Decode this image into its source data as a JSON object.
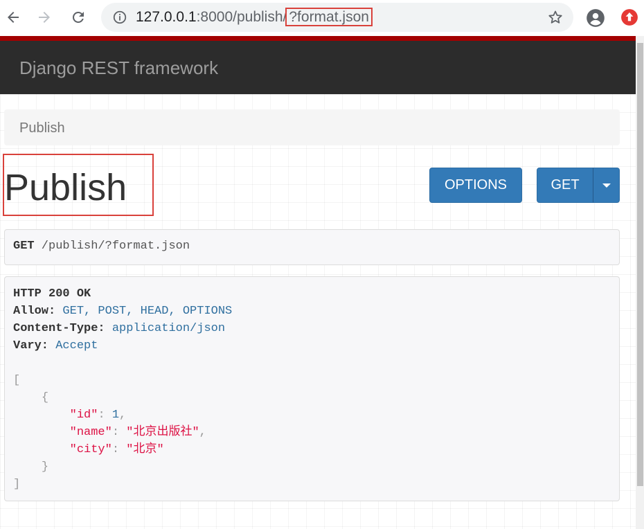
{
  "browser": {
    "url_host": "127.0.0.1",
    "url_port_path": ":8000/publish/",
    "url_query": "?format.json"
  },
  "navbar": {
    "brand": "Django REST framework"
  },
  "breadcrumb": {
    "current": "Publish"
  },
  "page": {
    "title": "Publish"
  },
  "buttons": {
    "options": "OPTIONS",
    "get": "GET"
  },
  "request": {
    "method": "GET",
    "path": " /publish/?format.json"
  },
  "response": {
    "status": "HTTP 200 OK",
    "headers": [
      {
        "name": "Allow:",
        "value": " GET, POST, HEAD, OPTIONS"
      },
      {
        "name": "Content-Type:",
        "value": " application/json"
      },
      {
        "name": "Vary:",
        "value": " Accept"
      }
    ],
    "body": {
      "open_bracket": "[",
      "open_brace": "{",
      "id_key": "\"id\"",
      "id_value": "1",
      "name_key": "\"name\"",
      "name_value": "\"北京出版社\"",
      "city_key": "\"city\"",
      "city_value": "\"北京\"",
      "close_brace": "}",
      "close_bracket": "]"
    }
  },
  "colors": {
    "accent": "#a30000",
    "navbar": "#2c2c2c",
    "button": "#337ab7",
    "highlight": "#d9413b"
  }
}
